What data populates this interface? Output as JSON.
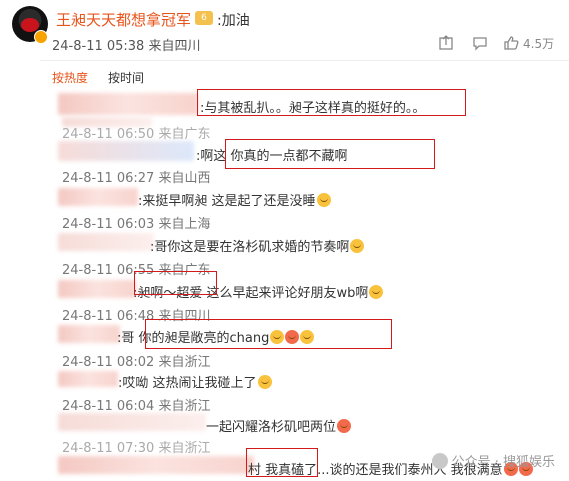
{
  "post": {
    "username": "王昶天天都想拿冠军",
    "level": "6",
    "text": ":加油",
    "meta": "24-8-11 05:38 来自四川",
    "like_count": "4.5万"
  },
  "sort_tabs": {
    "hot": "按热度",
    "time": "按时间"
  },
  "comments": [
    {
      "text": ":与其被乱扒。。昶子这样真的挺好的。。",
      "meta": "24-8-11 06:50 来自广东"
    },
    {
      "text": ":啊这  你真的一点都不藏啊",
      "meta": "24-8-11 06:27 来自山西"
    },
    {
      "text": ":来挺早啊昶  这是起了还是没睡",
      "meta": "24-8-11 06:03 来自上海"
    },
    {
      "text": ":哥你这是要在洛杉矶求婚的节奏啊",
      "meta": "24-8-11 06:55 来自广东"
    },
    {
      "text": ":昶啊～超爱  这么早起来评论好朋友wb啊",
      "meta": "24-8-11 06:48 来自四川"
    },
    {
      "text": ":哥  你的昶是敞亮的chang",
      "meta": "24-8-11 08:02 来自浙江"
    },
    {
      "text": ":哎呦  这热闹让我碰上了",
      "meta": "24-8-11 06:04 来自浙江"
    },
    {
      "text": "一起闪耀洛杉矶吧两位",
      "meta": "24-8-11 07:30 来自浙江"
    },
    {
      "text_a": "村  我真磕了",
      "text_b": "...谈的还是我们泰州人 我很满意"
    }
  ],
  "watermark": "公众号 · 搜狐娱乐",
  "colors": {
    "accent": "#e8541b",
    "highlight_box": "#d21a1a"
  },
  "icons": [
    "avatar",
    "verified-badge",
    "level-badge",
    "share-icon",
    "comment-icon",
    "like-icon",
    "emoji-icon"
  ]
}
